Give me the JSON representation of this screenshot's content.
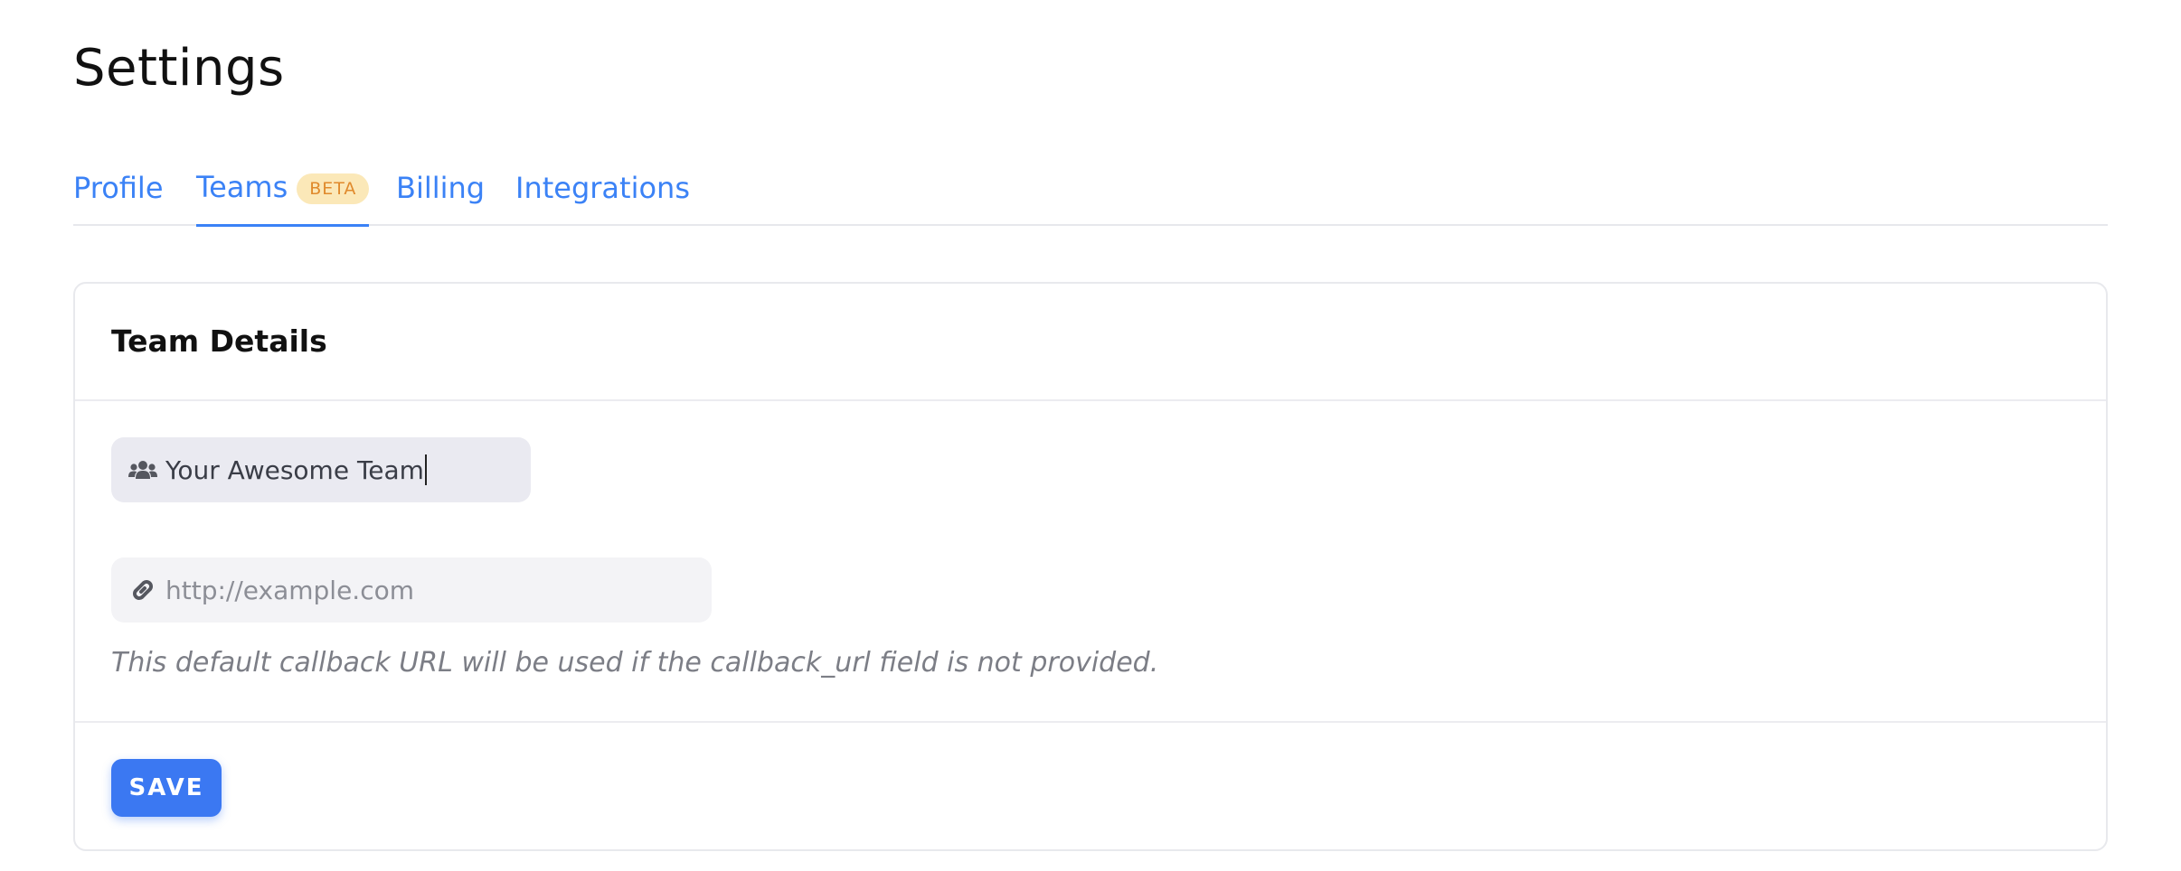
{
  "page": {
    "title": "Settings"
  },
  "tabs": [
    {
      "label": "Profile",
      "active": false
    },
    {
      "label": "Teams",
      "active": true,
      "badge": "BETA"
    },
    {
      "label": "Billing",
      "active": false
    },
    {
      "label": "Integrations",
      "active": false
    }
  ],
  "card": {
    "title": "Team Details",
    "team_name": {
      "value": "Your Awesome Team",
      "icon": "users-icon"
    },
    "callback_url": {
      "value": "",
      "placeholder": "http://example.com",
      "icon": "link-icon"
    },
    "helper_text": "This default callback URL will be used if the callback_url field is not provided.",
    "save_label": "SAVE"
  },
  "colors": {
    "accent": "#3b82f6",
    "badge_bg": "#fbe8b8",
    "badge_text": "#e08a2c",
    "save_button": "#3b78f2"
  }
}
